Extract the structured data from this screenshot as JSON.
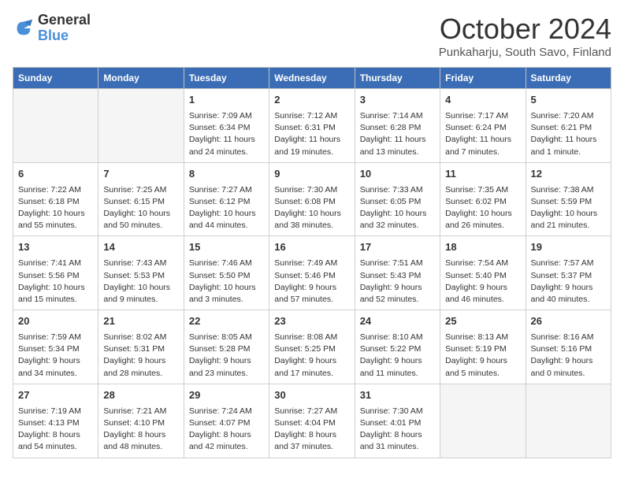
{
  "header": {
    "logo_line1": "General",
    "logo_line2": "Blue",
    "month_title": "October 2024",
    "subtitle": "Punkaharju, South Savo, Finland"
  },
  "days_of_week": [
    "Sunday",
    "Monday",
    "Tuesday",
    "Wednesday",
    "Thursday",
    "Friday",
    "Saturday"
  ],
  "weeks": [
    [
      {
        "day": "",
        "empty": true
      },
      {
        "day": "",
        "empty": true
      },
      {
        "day": "1",
        "sunrise": "7:09 AM",
        "sunset": "6:34 PM",
        "daylight": "11 hours and 24 minutes."
      },
      {
        "day": "2",
        "sunrise": "7:12 AM",
        "sunset": "6:31 PM",
        "daylight": "11 hours and 19 minutes."
      },
      {
        "day": "3",
        "sunrise": "7:14 AM",
        "sunset": "6:28 PM",
        "daylight": "11 hours and 13 minutes."
      },
      {
        "day": "4",
        "sunrise": "7:17 AM",
        "sunset": "6:24 PM",
        "daylight": "11 hours and 7 minutes."
      },
      {
        "day": "5",
        "sunrise": "7:20 AM",
        "sunset": "6:21 PM",
        "daylight": "11 hours and 1 minute."
      }
    ],
    [
      {
        "day": "6",
        "sunrise": "7:22 AM",
        "sunset": "6:18 PM",
        "daylight": "10 hours and 55 minutes."
      },
      {
        "day": "7",
        "sunrise": "7:25 AM",
        "sunset": "6:15 PM",
        "daylight": "10 hours and 50 minutes."
      },
      {
        "day": "8",
        "sunrise": "7:27 AM",
        "sunset": "6:12 PM",
        "daylight": "10 hours and 44 minutes."
      },
      {
        "day": "9",
        "sunrise": "7:30 AM",
        "sunset": "6:08 PM",
        "daylight": "10 hours and 38 minutes."
      },
      {
        "day": "10",
        "sunrise": "7:33 AM",
        "sunset": "6:05 PM",
        "daylight": "10 hours and 32 minutes."
      },
      {
        "day": "11",
        "sunrise": "7:35 AM",
        "sunset": "6:02 PM",
        "daylight": "10 hours and 26 minutes."
      },
      {
        "day": "12",
        "sunrise": "7:38 AM",
        "sunset": "5:59 PM",
        "daylight": "10 hours and 21 minutes."
      }
    ],
    [
      {
        "day": "13",
        "sunrise": "7:41 AM",
        "sunset": "5:56 PM",
        "daylight": "10 hours and 15 minutes."
      },
      {
        "day": "14",
        "sunrise": "7:43 AM",
        "sunset": "5:53 PM",
        "daylight": "10 hours and 9 minutes."
      },
      {
        "day": "15",
        "sunrise": "7:46 AM",
        "sunset": "5:50 PM",
        "daylight": "10 hours and 3 minutes."
      },
      {
        "day": "16",
        "sunrise": "7:49 AM",
        "sunset": "5:46 PM",
        "daylight": "9 hours and 57 minutes."
      },
      {
        "day": "17",
        "sunrise": "7:51 AM",
        "sunset": "5:43 PM",
        "daylight": "9 hours and 52 minutes."
      },
      {
        "day": "18",
        "sunrise": "7:54 AM",
        "sunset": "5:40 PM",
        "daylight": "9 hours and 46 minutes."
      },
      {
        "day": "19",
        "sunrise": "7:57 AM",
        "sunset": "5:37 PM",
        "daylight": "9 hours and 40 minutes."
      }
    ],
    [
      {
        "day": "20",
        "sunrise": "7:59 AM",
        "sunset": "5:34 PM",
        "daylight": "9 hours and 34 minutes."
      },
      {
        "day": "21",
        "sunrise": "8:02 AM",
        "sunset": "5:31 PM",
        "daylight": "9 hours and 28 minutes."
      },
      {
        "day": "22",
        "sunrise": "8:05 AM",
        "sunset": "5:28 PM",
        "daylight": "9 hours and 23 minutes."
      },
      {
        "day": "23",
        "sunrise": "8:08 AM",
        "sunset": "5:25 PM",
        "daylight": "9 hours and 17 minutes."
      },
      {
        "day": "24",
        "sunrise": "8:10 AM",
        "sunset": "5:22 PM",
        "daylight": "9 hours and 11 minutes."
      },
      {
        "day": "25",
        "sunrise": "8:13 AM",
        "sunset": "5:19 PM",
        "daylight": "9 hours and 5 minutes."
      },
      {
        "day": "26",
        "sunrise": "8:16 AM",
        "sunset": "5:16 PM",
        "daylight": "9 hours and 0 minutes."
      }
    ],
    [
      {
        "day": "27",
        "sunrise": "7:19 AM",
        "sunset": "4:13 PM",
        "daylight": "8 hours and 54 minutes."
      },
      {
        "day": "28",
        "sunrise": "7:21 AM",
        "sunset": "4:10 PM",
        "daylight": "8 hours and 48 minutes."
      },
      {
        "day": "29",
        "sunrise": "7:24 AM",
        "sunset": "4:07 PM",
        "daylight": "8 hours and 42 minutes."
      },
      {
        "day": "30",
        "sunrise": "7:27 AM",
        "sunset": "4:04 PM",
        "daylight": "8 hours and 37 minutes."
      },
      {
        "day": "31",
        "sunrise": "7:30 AM",
        "sunset": "4:01 PM",
        "daylight": "8 hours and 31 minutes."
      },
      {
        "day": "",
        "empty": true
      },
      {
        "day": "",
        "empty": true
      }
    ]
  ]
}
